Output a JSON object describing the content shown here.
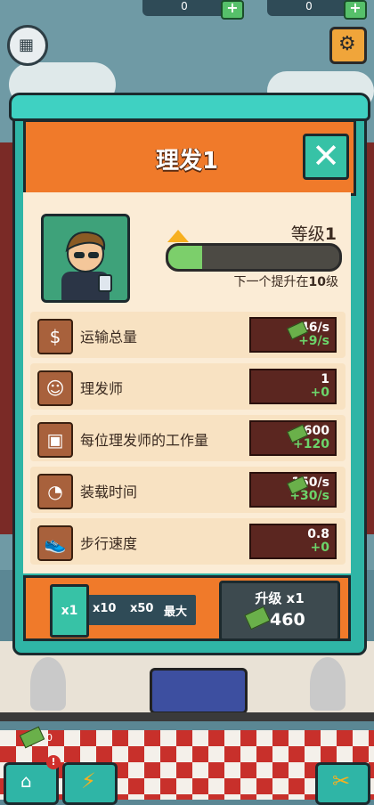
{
  "topbar": {
    "cash_count": "0",
    "gem_count": "0"
  },
  "panel": {
    "title": "理发1",
    "level_prefix": "等级",
    "level_value": "1",
    "progress_fraction": 0.2,
    "next_level_text": "下一个提升在",
    "next_level_value": "10",
    "next_level_suffix": "级"
  },
  "stats": [
    {
      "label": "运输总量",
      "value": "46/s",
      "increment": "+9/s",
      "icon": "cash-deposit-icon",
      "has_cash": true
    },
    {
      "label": "理发师",
      "value": "1",
      "increment": "+0",
      "icon": "barber-icon",
      "has_cash": false
    },
    {
      "label": "每位理发师的工作量",
      "value": "600",
      "increment": "+120",
      "icon": "workload-icon",
      "has_cash": true
    },
    {
      "label": "装载时间",
      "value": "150/s",
      "increment": "+30/s",
      "icon": "loading-time-icon",
      "has_cash": true
    },
    {
      "label": "步行速度",
      "value": "0.8",
      "increment": "+0",
      "icon": "shoe-icon",
      "has_cash": false
    }
  ],
  "multiplier": {
    "options": [
      "x1",
      "x10",
      "x50",
      "最大"
    ],
    "selected": "x1"
  },
  "upgrade": {
    "label": "升级 x1",
    "cost": "460"
  },
  "floor_cash": "0",
  "colors": {
    "panel_teal": "#2fb5a6",
    "header_orange": "#f07a2a",
    "stat_value_bg": "#5b2620",
    "increment_green": "#6cd46a"
  }
}
